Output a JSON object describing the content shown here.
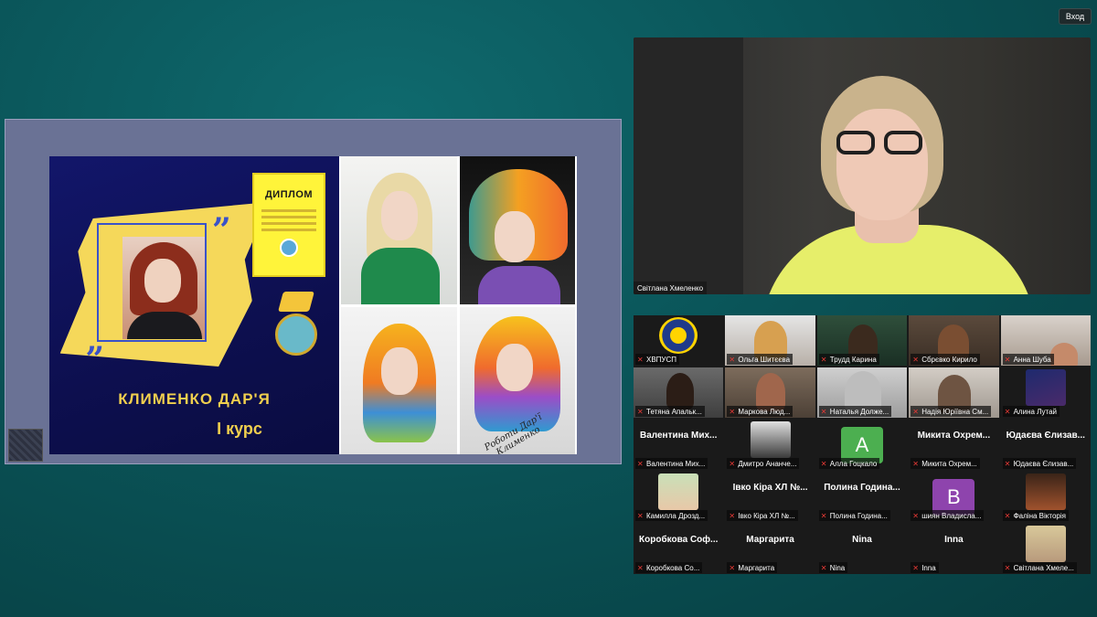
{
  "top_bar": {
    "enter_label": "Вход"
  },
  "shared_slide": {
    "diploma_label": "ДИПЛОМ",
    "name_line": "КЛИМЕНКО ДАР'Я",
    "course_line": "І курс",
    "signature": "Роботи Дар'ї Клименко"
  },
  "speaker": {
    "name": "Світлана Хмеленко",
    "shirt_color": "#e6ee6a"
  },
  "gallery": {
    "tiles": [
      {
        "label": "ХВПУСП",
        "big": "",
        "kind": "logo"
      },
      {
        "label": "Ольга Шитєєва",
        "big": "",
        "kind": "video"
      },
      {
        "label": "Трудд Карина",
        "big": "",
        "kind": "video"
      },
      {
        "label": "Сбрєвко Кирило",
        "big": "",
        "kind": "video"
      },
      {
        "label": "Анна Шуба",
        "big": "",
        "kind": "video"
      },
      {
        "label": "Тетяна Апальк...",
        "big": "",
        "kind": "video"
      },
      {
        "label": "Маркова Люд...",
        "big": "",
        "kind": "video"
      },
      {
        "label": "Наталья Долже...",
        "big": "",
        "kind": "video"
      },
      {
        "label": "Надія Юріївна См...",
        "big": "",
        "kind": "video"
      },
      {
        "label": "Алина Лутай",
        "big": "",
        "kind": "photo"
      },
      {
        "label": "Валентина Мих...",
        "big": "Валентина Мих...",
        "kind": "name"
      },
      {
        "label": "Дмитро Ананче...",
        "big": "",
        "kind": "photo"
      },
      {
        "label": "Алла Гоцкало",
        "big": "",
        "kind": "letter",
        "letter": "A",
        "color": "#4caf50"
      },
      {
        "label": "Микита Охрем...",
        "big": "Микита Охрем...",
        "kind": "name"
      },
      {
        "label": "Юдаєва Єлизав...",
        "big": "Юдаєва Єлизав...",
        "kind": "name"
      },
      {
        "label": "Камилла Дрозд...",
        "big": "",
        "kind": "photo"
      },
      {
        "label": "Івко Кіра ХЛ №...",
        "big": "Івко Кіра ХЛ №...",
        "kind": "name"
      },
      {
        "label": "Полина Година...",
        "big": "Полина Година...",
        "kind": "name"
      },
      {
        "label": "шиян Владисла...",
        "big": "",
        "kind": "letter",
        "letter": "В",
        "color": "#8e44ad"
      },
      {
        "label": "Фаліна Вікторія",
        "big": "",
        "kind": "photo"
      },
      {
        "label": "Коробкова Со...",
        "big": "Коробкова Соф...",
        "kind": "name"
      },
      {
        "label": "Маргарита",
        "big": "Маргарита",
        "kind": "name"
      },
      {
        "label": "Nina",
        "big": "Nina",
        "kind": "name"
      },
      {
        "label": "Inna",
        "big": "Inna",
        "kind": "name"
      },
      {
        "label": "Світлана Хмеле...",
        "big": "",
        "kind": "photo"
      }
    ]
  }
}
